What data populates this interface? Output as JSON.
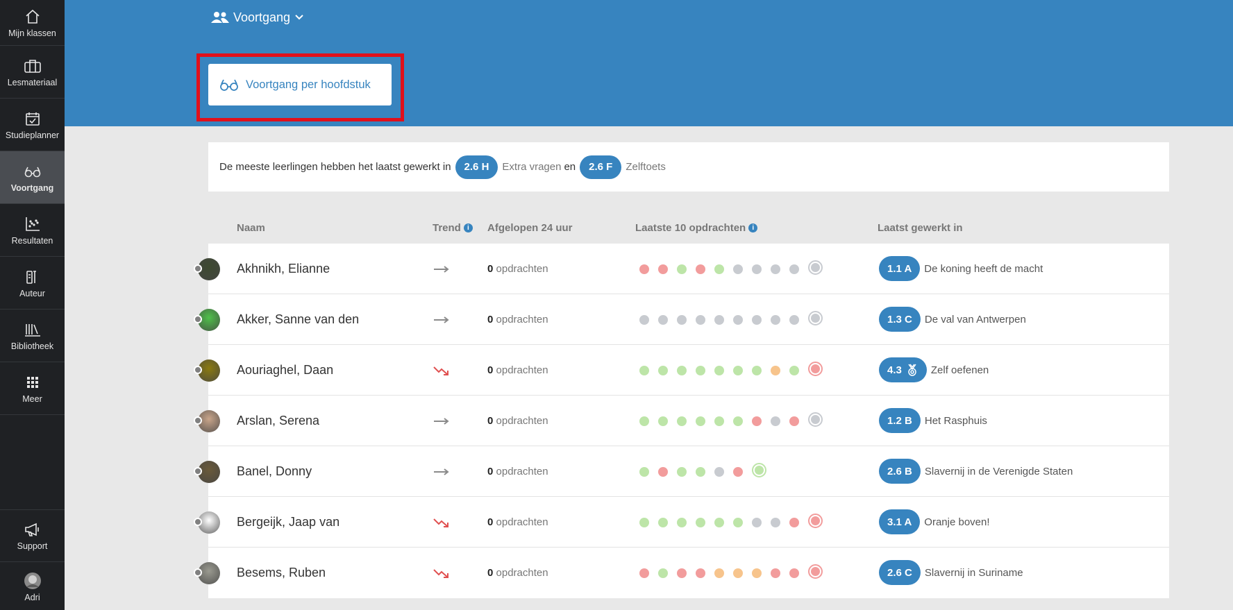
{
  "sidebar": {
    "items": [
      {
        "label": "Mijn klassen",
        "icon": "home-icon"
      },
      {
        "label": "Lesmateriaal",
        "icon": "briefcase-icon"
      },
      {
        "label": "Studieplanner",
        "icon": "calendar-check-icon"
      },
      {
        "label": "Voortgang",
        "icon": "glasses-icon",
        "active": true
      },
      {
        "label": "Resultaten",
        "icon": "scatter-chart-icon"
      },
      {
        "label": "Auteur",
        "icon": "author-icon"
      },
      {
        "label": "Bibliotheek",
        "icon": "library-icon"
      },
      {
        "label": "Meer",
        "icon": "grid-icon"
      },
      {
        "label": "Support",
        "icon": "megaphone-icon"
      },
      {
        "label": "Adri",
        "icon": "user-avatar"
      }
    ]
  },
  "header": {
    "dropdown_label": "Voortgang",
    "chapter_button_label": "Voortgang per hoofdstuk"
  },
  "summary": {
    "text_before": "De meeste leerlingen hebben het laatst gewerkt in",
    "pill1": "2.6 H",
    "label1": "Extra vragen",
    "connector": "en",
    "pill2": "2.6 F",
    "label2": "Zelftoets"
  },
  "table": {
    "columns": {
      "name": "Naam",
      "trend": "Trend",
      "last24": "Afgelopen 24 uur",
      "last10": "Laatste 10 opdrachten",
      "lastWorked": "Laatst gewerkt in"
    },
    "count_suffix": "opdrachten",
    "rows": [
      {
        "name": "Akhnikh, Elianne",
        "trend": "flat",
        "count": "0",
        "dots": [
          "red",
          "red",
          "green",
          "red",
          "green",
          "grey",
          "grey",
          "grey",
          "grey",
          "end-grey"
        ],
        "chapter": "1.1 A",
        "title": "De koning heeft de macht",
        "avatar": "#3d4a30"
      },
      {
        "name": "Akker, Sanne van den",
        "trend": "flat",
        "count": "0",
        "dots": [
          "grey",
          "grey",
          "grey",
          "grey",
          "grey",
          "grey",
          "grey",
          "grey",
          "grey",
          "end-grey"
        ],
        "chapter": "1.3 C",
        "title": "De val van Antwerpen",
        "avatar": "#4fc04a"
      },
      {
        "name": "Aouriaghel, Daan",
        "trend": "down",
        "count": "0",
        "dots": [
          "green",
          "green",
          "green",
          "green",
          "green",
          "green",
          "green",
          "orange",
          "green",
          "end-red"
        ],
        "chapter": "4.3",
        "trophy": true,
        "title": "Zelf oefenen",
        "avatar": "#8a7a10"
      },
      {
        "name": "Arslan, Serena",
        "trend": "flat",
        "count": "0",
        "dots": [
          "green",
          "green",
          "green",
          "green",
          "green",
          "green",
          "red",
          "grey",
          "red",
          "end-grey"
        ],
        "chapter": "1.2 B",
        "title": "Het Rasphuis",
        "avatar": "#c9a58a"
      },
      {
        "name": "Banel, Donny",
        "trend": "flat",
        "count": "0",
        "dots": [
          "green",
          "red",
          "green",
          "green",
          "grey",
          "red",
          "end-green"
        ],
        "chapter": "2.6 B",
        "title": "Slavernij in de Verenigde Staten",
        "avatar": "#6a5a3a"
      },
      {
        "name": "Bergeijk, Jaap van",
        "trend": "down",
        "count": "0",
        "dots": [
          "green",
          "green",
          "green",
          "green",
          "green",
          "green",
          "grey",
          "grey",
          "red",
          "end-red"
        ],
        "chapter": "3.1 A",
        "title": "Oranje boven!",
        "avatar": "#ffffff"
      },
      {
        "name": "Besems, Ruben",
        "trend": "down",
        "count": "0",
        "dots": [
          "red",
          "green",
          "red",
          "red",
          "orange",
          "orange",
          "orange",
          "red",
          "red",
          "end-red"
        ],
        "chapter": "2.6 C",
        "title": "Slavernij in Suriname",
        "avatar": "#9a9a90"
      }
    ]
  },
  "colors": {
    "brand": "#3784bf",
    "highlight": "#e0101b",
    "dot_green": "#bde5a8",
    "dot_red": "#f29c9c",
    "dot_grey": "#c8cbd0",
    "dot_orange": "#f7c48c",
    "trend_flat": "#8a8a8a",
    "trend_down": "#e05050"
  }
}
